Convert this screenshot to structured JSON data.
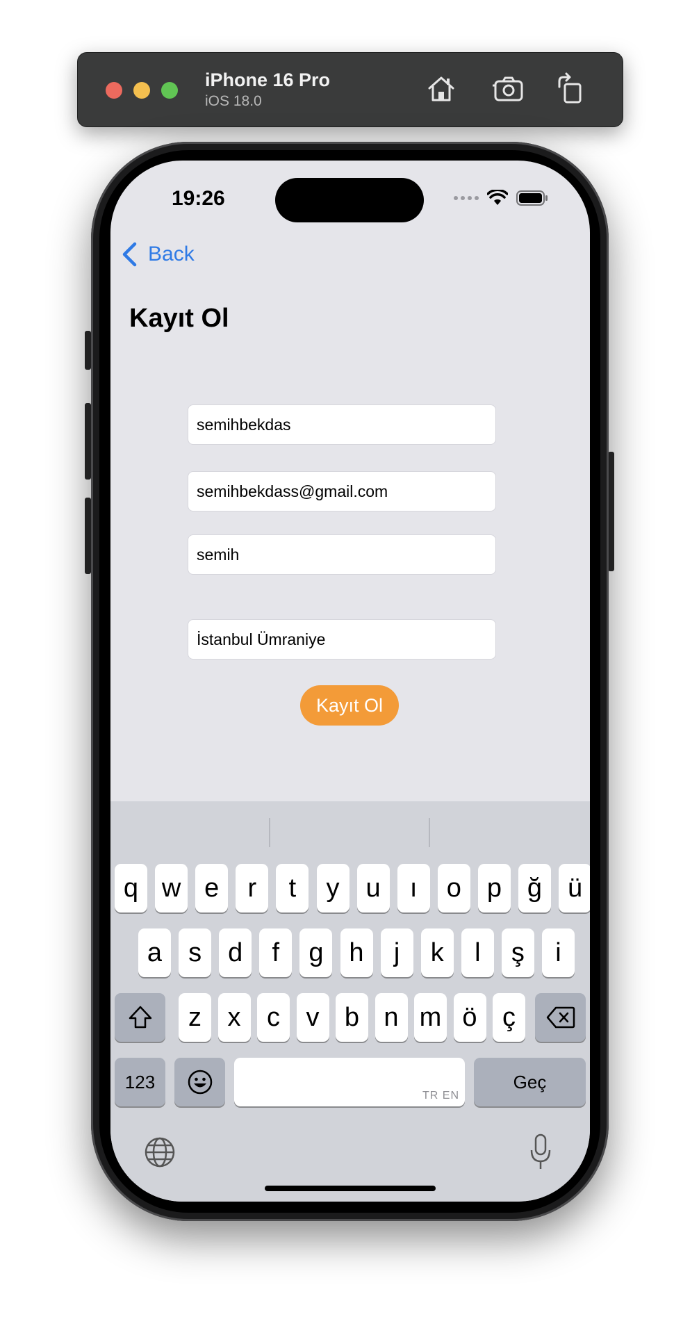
{
  "simulator": {
    "device_name": "iPhone 16 Pro",
    "os_version": "iOS 18.0",
    "icons": [
      "home-icon",
      "screenshot-icon",
      "rotate-icon"
    ]
  },
  "status_bar": {
    "time": "19:26"
  },
  "nav": {
    "back_label": "Back"
  },
  "page": {
    "title": "Kayıt Ol"
  },
  "form": {
    "username_value": "semihbekdas",
    "email_value": "semihbekdass@gmail.com",
    "password_value": "semih",
    "address_value": "İstanbul Ümraniye",
    "submit_label": "Kayıt Ol"
  },
  "keyboard": {
    "row1": [
      "q",
      "w",
      "e",
      "r",
      "t",
      "y",
      "u",
      "ı",
      "o",
      "p",
      "ğ",
      "ü"
    ],
    "row2": [
      "a",
      "s",
      "d",
      "f",
      "g",
      "h",
      "j",
      "k",
      "l",
      "ş",
      "i"
    ],
    "row3": [
      "z",
      "x",
      "c",
      "v",
      "b",
      "n",
      "m",
      "ö",
      "ç"
    ],
    "numbers_label": "123",
    "space_hint": "TR EN",
    "return_label": "Geç"
  },
  "colors": {
    "accent": "#2f7ae5",
    "button": "#f39b38",
    "background": "#e5e5ea",
    "keyboard": "#d1d3d9"
  }
}
